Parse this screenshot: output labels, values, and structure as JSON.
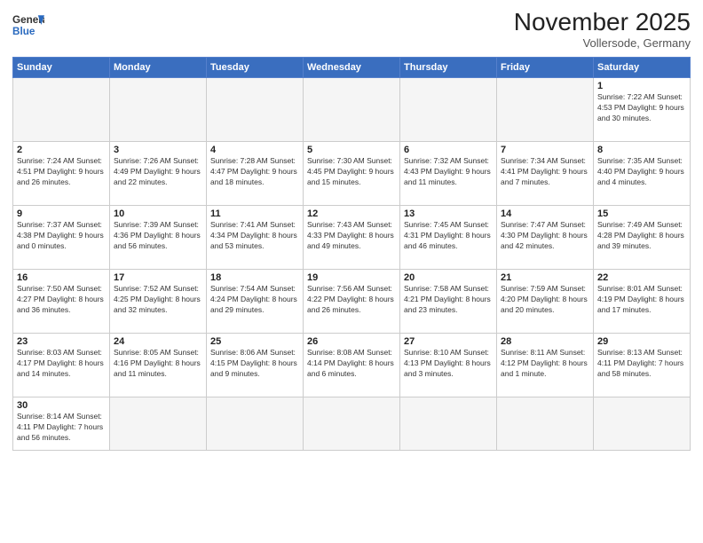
{
  "header": {
    "logo_general": "General",
    "logo_blue": "Blue",
    "month_title": "November 2025",
    "location": "Vollersode, Germany"
  },
  "weekdays": [
    "Sunday",
    "Monday",
    "Tuesday",
    "Wednesday",
    "Thursday",
    "Friday",
    "Saturday"
  ],
  "weeks": [
    [
      {
        "day": "",
        "info": ""
      },
      {
        "day": "",
        "info": ""
      },
      {
        "day": "",
        "info": ""
      },
      {
        "day": "",
        "info": ""
      },
      {
        "day": "",
        "info": ""
      },
      {
        "day": "",
        "info": ""
      },
      {
        "day": "1",
        "info": "Sunrise: 7:22 AM\nSunset: 4:53 PM\nDaylight: 9 hours\nand 30 minutes."
      }
    ],
    [
      {
        "day": "2",
        "info": "Sunrise: 7:24 AM\nSunset: 4:51 PM\nDaylight: 9 hours\nand 26 minutes."
      },
      {
        "day": "3",
        "info": "Sunrise: 7:26 AM\nSunset: 4:49 PM\nDaylight: 9 hours\nand 22 minutes."
      },
      {
        "day": "4",
        "info": "Sunrise: 7:28 AM\nSunset: 4:47 PM\nDaylight: 9 hours\nand 18 minutes."
      },
      {
        "day": "5",
        "info": "Sunrise: 7:30 AM\nSunset: 4:45 PM\nDaylight: 9 hours\nand 15 minutes."
      },
      {
        "day": "6",
        "info": "Sunrise: 7:32 AM\nSunset: 4:43 PM\nDaylight: 9 hours\nand 11 minutes."
      },
      {
        "day": "7",
        "info": "Sunrise: 7:34 AM\nSunset: 4:41 PM\nDaylight: 9 hours\nand 7 minutes."
      },
      {
        "day": "8",
        "info": "Sunrise: 7:35 AM\nSunset: 4:40 PM\nDaylight: 9 hours\nand 4 minutes."
      }
    ],
    [
      {
        "day": "9",
        "info": "Sunrise: 7:37 AM\nSunset: 4:38 PM\nDaylight: 9 hours\nand 0 minutes."
      },
      {
        "day": "10",
        "info": "Sunrise: 7:39 AM\nSunset: 4:36 PM\nDaylight: 8 hours\nand 56 minutes."
      },
      {
        "day": "11",
        "info": "Sunrise: 7:41 AM\nSunset: 4:34 PM\nDaylight: 8 hours\nand 53 minutes."
      },
      {
        "day": "12",
        "info": "Sunrise: 7:43 AM\nSunset: 4:33 PM\nDaylight: 8 hours\nand 49 minutes."
      },
      {
        "day": "13",
        "info": "Sunrise: 7:45 AM\nSunset: 4:31 PM\nDaylight: 8 hours\nand 46 minutes."
      },
      {
        "day": "14",
        "info": "Sunrise: 7:47 AM\nSunset: 4:30 PM\nDaylight: 8 hours\nand 42 minutes."
      },
      {
        "day": "15",
        "info": "Sunrise: 7:49 AM\nSunset: 4:28 PM\nDaylight: 8 hours\nand 39 minutes."
      }
    ],
    [
      {
        "day": "16",
        "info": "Sunrise: 7:50 AM\nSunset: 4:27 PM\nDaylight: 8 hours\nand 36 minutes."
      },
      {
        "day": "17",
        "info": "Sunrise: 7:52 AM\nSunset: 4:25 PM\nDaylight: 8 hours\nand 32 minutes."
      },
      {
        "day": "18",
        "info": "Sunrise: 7:54 AM\nSunset: 4:24 PM\nDaylight: 8 hours\nand 29 minutes."
      },
      {
        "day": "19",
        "info": "Sunrise: 7:56 AM\nSunset: 4:22 PM\nDaylight: 8 hours\nand 26 minutes."
      },
      {
        "day": "20",
        "info": "Sunrise: 7:58 AM\nSunset: 4:21 PM\nDaylight: 8 hours\nand 23 minutes."
      },
      {
        "day": "21",
        "info": "Sunrise: 7:59 AM\nSunset: 4:20 PM\nDaylight: 8 hours\nand 20 minutes."
      },
      {
        "day": "22",
        "info": "Sunrise: 8:01 AM\nSunset: 4:19 PM\nDaylight: 8 hours\nand 17 minutes."
      }
    ],
    [
      {
        "day": "23",
        "info": "Sunrise: 8:03 AM\nSunset: 4:17 PM\nDaylight: 8 hours\nand 14 minutes."
      },
      {
        "day": "24",
        "info": "Sunrise: 8:05 AM\nSunset: 4:16 PM\nDaylight: 8 hours\nand 11 minutes."
      },
      {
        "day": "25",
        "info": "Sunrise: 8:06 AM\nSunset: 4:15 PM\nDaylight: 8 hours\nand 9 minutes."
      },
      {
        "day": "26",
        "info": "Sunrise: 8:08 AM\nSunset: 4:14 PM\nDaylight: 8 hours\nand 6 minutes."
      },
      {
        "day": "27",
        "info": "Sunrise: 8:10 AM\nSunset: 4:13 PM\nDaylight: 8 hours\nand 3 minutes."
      },
      {
        "day": "28",
        "info": "Sunrise: 8:11 AM\nSunset: 4:12 PM\nDaylight: 8 hours\nand 1 minute."
      },
      {
        "day": "29",
        "info": "Sunrise: 8:13 AM\nSunset: 4:11 PM\nDaylight: 7 hours\nand 58 minutes."
      }
    ],
    [
      {
        "day": "30",
        "info": "Sunrise: 8:14 AM\nSunset: 4:11 PM\nDaylight: 7 hours\nand 56 minutes."
      },
      {
        "day": "",
        "info": ""
      },
      {
        "day": "",
        "info": ""
      },
      {
        "day": "",
        "info": ""
      },
      {
        "day": "",
        "info": ""
      },
      {
        "day": "",
        "info": ""
      },
      {
        "day": "",
        "info": ""
      }
    ]
  ]
}
